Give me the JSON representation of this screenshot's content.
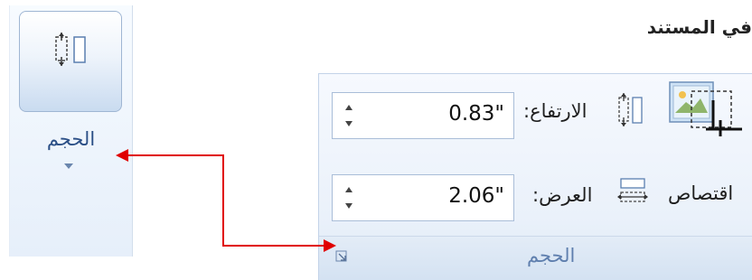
{
  "heading": "في المستند",
  "collapsed_group": {
    "label": "الحجم"
  },
  "size_group": {
    "height_label": "الارتفاع:",
    "height_value": "0.83\"",
    "width_label": "العرض:",
    "width_value": "2.06\"",
    "crop_label": "اقتصاص",
    "group_label": "الحجم"
  },
  "colors": {
    "arrow": "#e00000",
    "ribbon_text": "#2b4f86",
    "spinner_border": "#a9bdd8"
  }
}
